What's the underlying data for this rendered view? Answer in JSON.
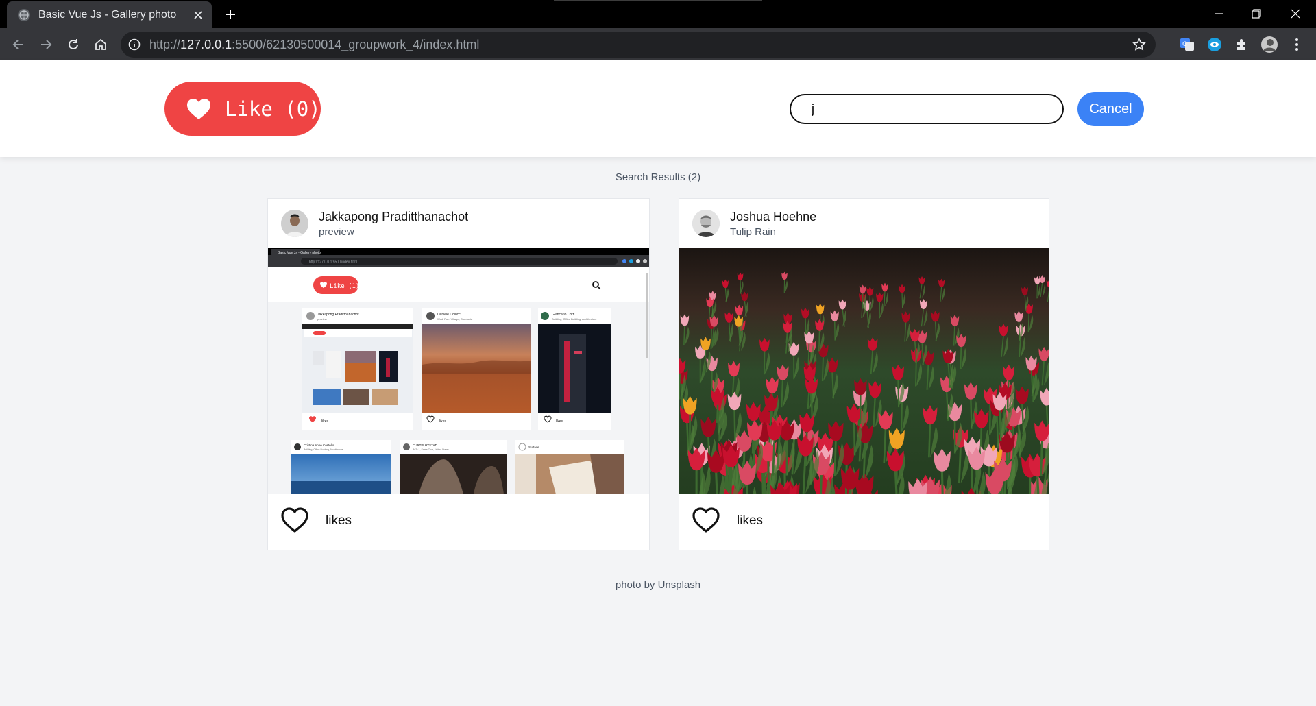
{
  "browser": {
    "tab_title": "Basic Vue Js - Gallery photo",
    "url_prefix": "http://",
    "url_host": "127.0.0.1",
    "url_rest": ":5500/62130500014_groupwork_4/index.html"
  },
  "header": {
    "like_label": "Like (0)",
    "search_value": "j",
    "cancel_label": "Cancel"
  },
  "results": {
    "label": "Search Results (2)"
  },
  "cards": [
    {
      "author": "Jakkapong Praditthanachot",
      "subtitle": "preview",
      "likes_label": "likes",
      "preview": {
        "tab_title": "Basic Vue Js - Gallery photo",
        "url": "http://127.0.0.1:5500/index.html",
        "like_label": "Like (1)",
        "mini_cards": [
          {
            "author": "Jakkapong Praditthanachot",
            "subtitle": "preview",
            "likes": "likes"
          },
          {
            "author": "Daniele Colucci",
            "subtitle": "Wadi Rum Village, Giordania",
            "likes": "likes"
          },
          {
            "author": "Giancarlo Corti",
            "subtitle": "Building, Office Building, Architecture",
            "likes": "likes"
          },
          {
            "author": "Cristina Anne Costello",
            "subtitle": "Building, Office Building, Architecture"
          },
          {
            "author": "CURTIS HYSTAD",
            "subtitle": "BCD-1, Santa Cruz, United States"
          },
          {
            "author": "Surface",
            "subtitle": ""
          }
        ]
      }
    },
    {
      "author": "Joshua Hoehne",
      "subtitle": "Tulip Rain",
      "likes_label": "likes"
    }
  ],
  "footer": {
    "credit": "photo by Unsplash"
  },
  "colors": {
    "like_red": "#ef4444",
    "cancel_blue": "#3b82f6",
    "page_bg": "#f3f4f6"
  }
}
